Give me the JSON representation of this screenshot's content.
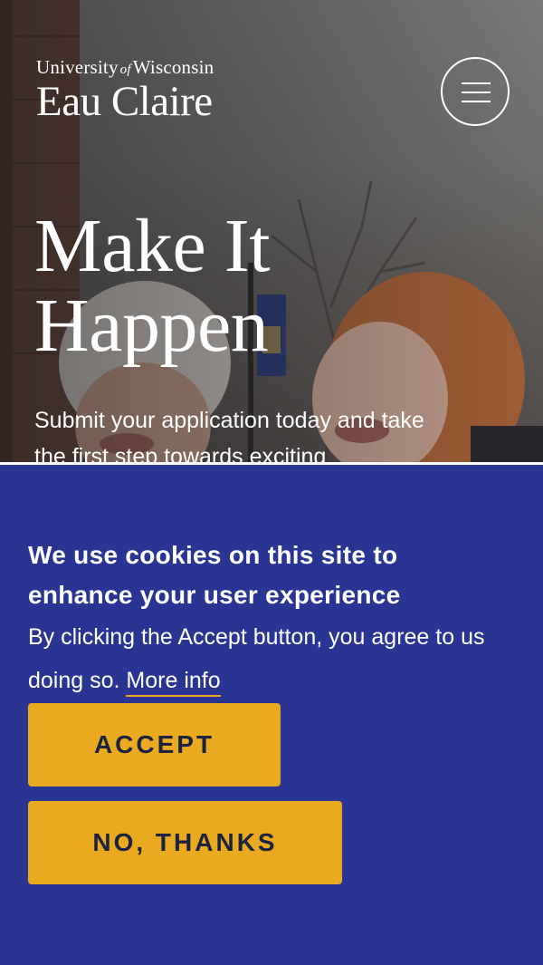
{
  "header": {
    "logo_line1_a": "University",
    "logo_line1_of": "of",
    "logo_line1_b": "Wisconsin",
    "logo_line2": "Eau Claire",
    "menu_icon": "hamburger-menu-icon"
  },
  "hero": {
    "title_line1": "Make It",
    "title_line2": "Happen",
    "text": "Submit your application today and take the first step towards exciting"
  },
  "cookie_banner": {
    "heading": "We use cookies on this site to enhance your user experience",
    "body": "By clicking the Accept button, you agree to us doing so.",
    "more_info_link": "More info",
    "accept_label": "ACCEPT",
    "decline_label": "NO, THANKS"
  },
  "colors": {
    "banner_background": "#2a3593",
    "button_background": "#eaaa20",
    "button_text": "#1c2340",
    "link_underline": "#e8a920"
  }
}
